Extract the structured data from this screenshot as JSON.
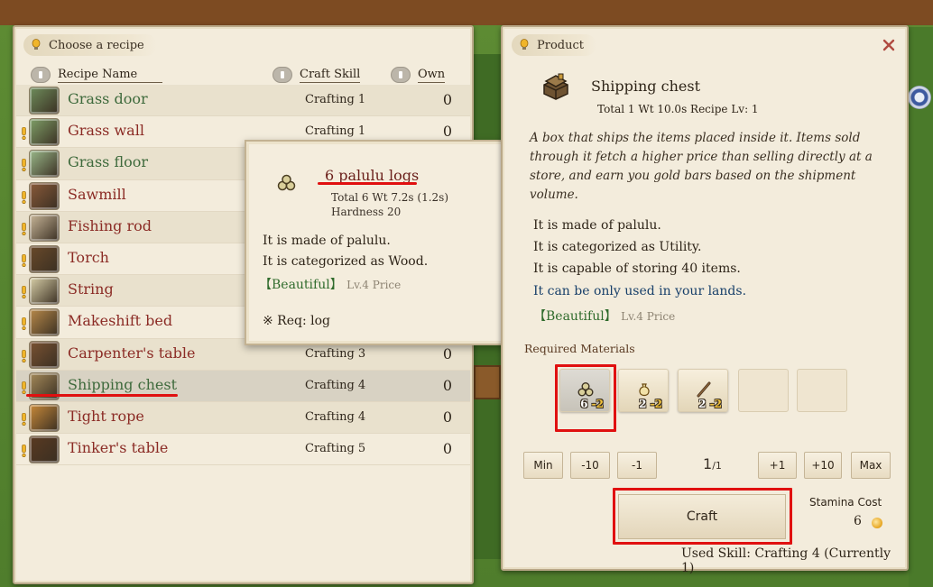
{
  "recipe_panel": {
    "header": "Choose a recipe",
    "columns": {
      "name": "Recipe Name",
      "skill": "Craft Skill",
      "own": "Own"
    },
    "recipes": [
      {
        "name": "Grass door",
        "skill": "Crafting 1",
        "own": "0",
        "color": "green",
        "warn": false,
        "icon": "grass-door-icon"
      },
      {
        "name": "Grass wall",
        "skill": "Crafting 1",
        "own": "0",
        "color": "red",
        "warn": true,
        "icon": "grass-wall-icon"
      },
      {
        "name": "Grass floor",
        "skill": "",
        "own": "",
        "color": "green",
        "warn": true,
        "icon": "grass-floor-icon"
      },
      {
        "name": "Sawmill",
        "skill": "",
        "own": "",
        "color": "red",
        "warn": true,
        "icon": "sawmill-icon"
      },
      {
        "name": "Fishing rod",
        "skill": "",
        "own": "",
        "color": "red",
        "warn": true,
        "icon": "fishing-rod-icon"
      },
      {
        "name": "Torch",
        "skill": "",
        "own": "",
        "color": "red",
        "warn": true,
        "icon": "torch-icon"
      },
      {
        "name": "String",
        "skill": "",
        "own": "",
        "color": "red",
        "warn": true,
        "icon": "string-icon"
      },
      {
        "name": "Makeshift bed",
        "skill": "",
        "own": "",
        "color": "red",
        "warn": true,
        "icon": "bed-icon"
      },
      {
        "name": "Carpenter's table",
        "skill": "Crafting 3",
        "own": "0",
        "color": "red",
        "warn": true,
        "icon": "carpenter-table-icon"
      },
      {
        "name": "Shipping chest",
        "skill": "Crafting 4",
        "own": "0",
        "color": "green",
        "warn": true,
        "icon": "chest-icon",
        "selected": true
      },
      {
        "name": "Tight rope",
        "skill": "Crafting 4",
        "own": "0",
        "color": "red",
        "warn": true,
        "icon": "rope-icon"
      },
      {
        "name": "Tinker's table",
        "skill": "Crafting 5",
        "own": "0",
        "color": "red",
        "warn": true,
        "icon": "tinker-table-icon"
      }
    ]
  },
  "tooltip": {
    "title": "6 palulu logs",
    "stats": "Total 6  Wt 7.2s (1.2s)",
    "hardness": "Hardness 20",
    "line1": "It is made of palulu.",
    "line2": "It is categorized as Wood.",
    "beautiful": "【Beautiful】",
    "beautiful_lv": "Lv.4 Price",
    "req": "※ Req: log"
  },
  "product": {
    "header": "Product",
    "name": "Shipping chest",
    "stats": "Total 1  Wt 10.0s  Recipe Lv: 1",
    "description": "A box that ships the items placed inside it. Items sold through it fetch a higher price than selling directly at a store, and earn you gold bars based on the shipment volume.",
    "props": [
      "It is made of palulu.",
      "It is categorized as Utility.",
      "It is capable of storing 40 items."
    ],
    "lands_prop": "It can be only used in your lands.",
    "beautiful": "【Beautiful】",
    "beautiful_lv": "Lv.4 Price",
    "required_label": "Required Materials",
    "materials": [
      {
        "icon": "log-icon",
        "have": "6",
        "need": "-2"
      },
      {
        "icon": "pouch-icon",
        "have": "2",
        "need": "-2"
      },
      {
        "icon": "stick-icon",
        "have": "2",
        "need": "-2"
      }
    ],
    "qty_buttons": [
      "Min",
      "-10",
      "-1",
      "+1",
      "+10",
      "Max"
    ],
    "qty_current": "1",
    "qty_max": "/1",
    "craft_label": "Craft",
    "stamina_label": "Stamina Cost",
    "stamina_value": "6",
    "used_skill": "Used Skill: Crafting 4 (Currently 1)"
  },
  "colors": {
    "panel_bg": "#f3ecdc",
    "recipe_red": "#8b2b25",
    "recipe_green": "#3e6a3c",
    "highlight_red": "#e01010"
  }
}
